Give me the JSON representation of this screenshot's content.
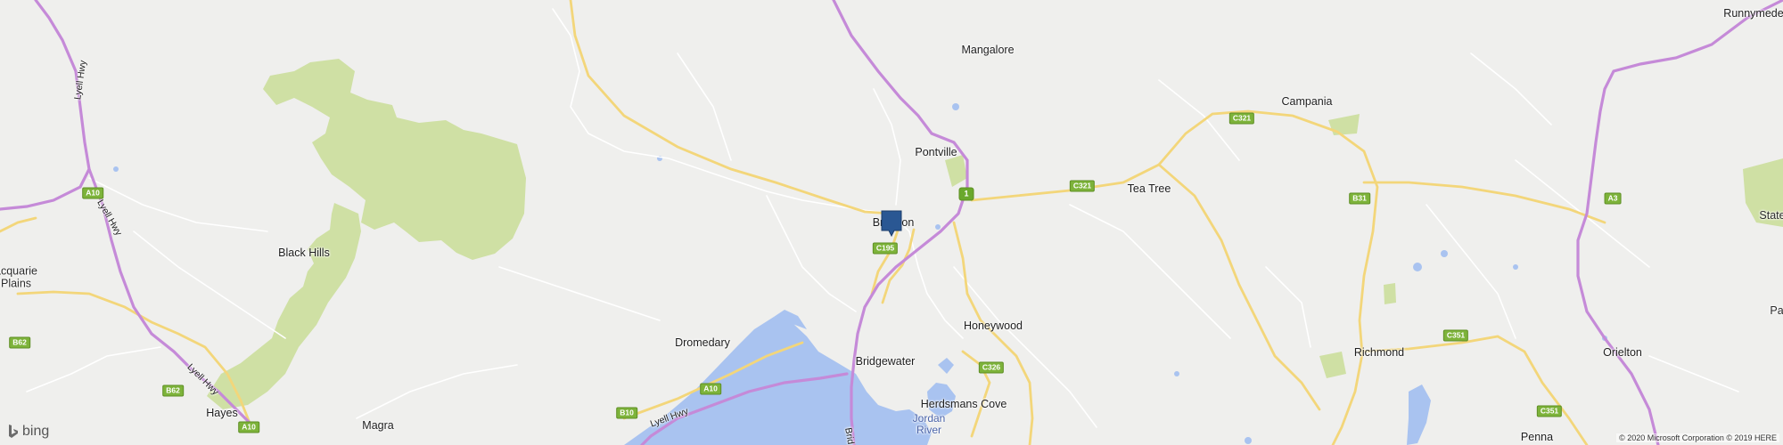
{
  "map": {
    "colors": {
      "background": "#efefed",
      "parkland": "#cfe0a4",
      "water": "#a9c3f0",
      "highway": "#c58ad8",
      "major_road": "#f3d67a",
      "minor_road": "#ffffff",
      "shield": "#7db33a",
      "pin": "#2a5793"
    },
    "places": [
      {
        "name": "Runnymede"
      },
      {
        "name": "Mangalore"
      },
      {
        "name": "Campania"
      },
      {
        "name": "Pontville"
      },
      {
        "name": "Tea Tree"
      },
      {
        "name": "Black Hills"
      },
      {
        "name": "acquarie\nPlains"
      },
      {
        "name": "Brighton"
      },
      {
        "name": "Honeywood"
      },
      {
        "name": "Dromedary"
      },
      {
        "name": "Bridgewater"
      },
      {
        "name": "Richmond"
      },
      {
        "name": "Orielton"
      },
      {
        "name": "Herdsmans Cove"
      },
      {
        "name": "Jordan\nRiver"
      },
      {
        "name": "Hayes"
      },
      {
        "name": "Magra"
      },
      {
        "name": "Penna"
      },
      {
        "name": "State"
      },
      {
        "name": "Pa"
      }
    ],
    "road_labels": [
      {
        "text": "Lyell Hwy"
      },
      {
        "text": "Lyell Hwy"
      },
      {
        "text": "Lyell Hwy"
      },
      {
        "text": "Lyell Hwy"
      },
      {
        "text": "Brid"
      }
    ],
    "shields": [
      {
        "code": "A10"
      },
      {
        "code": "B62"
      },
      {
        "code": "B62"
      },
      {
        "code": "A10"
      },
      {
        "code": "B10"
      },
      {
        "code": "A10"
      },
      {
        "code": "C195"
      },
      {
        "code": "1"
      },
      {
        "code": "C321"
      },
      {
        "code": "C321"
      },
      {
        "code": "C326"
      },
      {
        "code": "B31"
      },
      {
        "code": "C351"
      },
      {
        "code": "C351"
      },
      {
        "code": "A3"
      }
    ],
    "pin_label": "Brighton location marker",
    "attribution": "© 2020 Microsoft Corporation © 2019 HERE",
    "logo_text": "bing"
  }
}
